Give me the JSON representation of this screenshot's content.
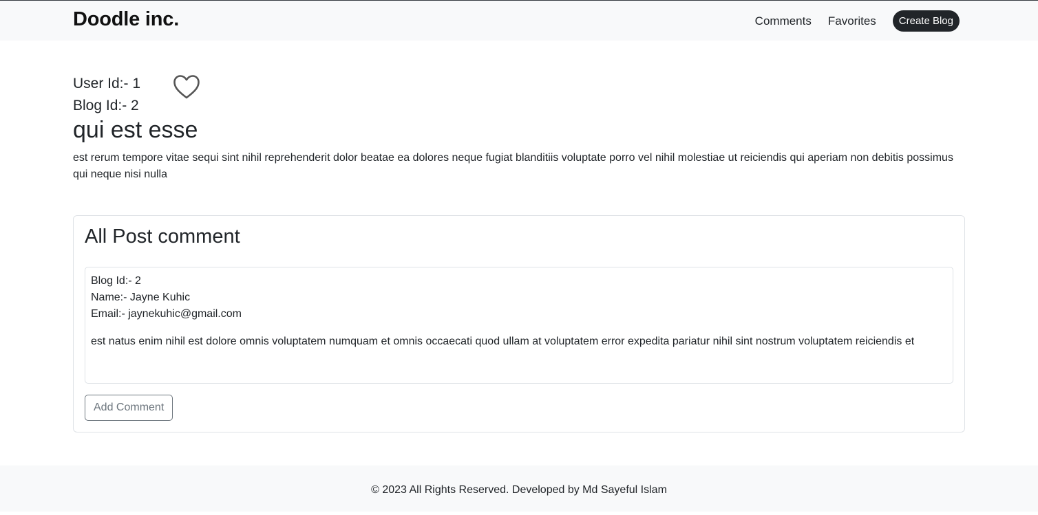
{
  "navbar": {
    "brand": "Doodle inc.",
    "links": [
      {
        "label": "Comments"
      },
      {
        "label": "Favorites"
      }
    ],
    "create_button": "Create Blog"
  },
  "post": {
    "user_id": "User Id:- 1",
    "blog_id": "Blog Id:- 2",
    "favorite_icon": "heart-outline-icon",
    "title": "qui est esse",
    "body": "est rerum tempore vitae sequi sint nihil reprehenderit dolor beatae ea dolores neque fugiat blanditiis voluptate porro vel nihil molestiae ut reiciendis qui aperiam non debitis possimus qui neque nisi nulla"
  },
  "comments_section": {
    "title": "All Post comment",
    "comments": [
      {
        "blog_id": "Blog Id:- 2",
        "name": "Name:- Jayne Kuhic",
        "email": "Email:- jaynekuhic@gmail.com",
        "body": "est natus enim nihil est dolore omnis voluptatem numquam et omnis occaecati quod ullam at voluptatem error expedita pariatur nihil sint nostrum voluptatem reiciendis et"
      }
    ],
    "add_button": "Add Comment"
  },
  "footer": {
    "text": "© 2023 All Rights Reserved. Developed by Md Sayeful Islam"
  }
}
